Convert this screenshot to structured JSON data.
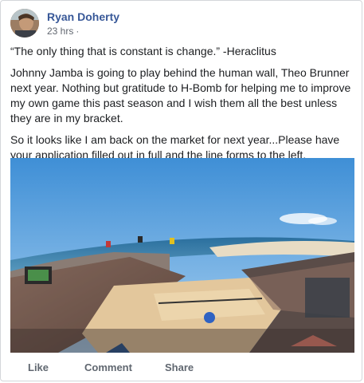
{
  "post": {
    "author": "Ryan Doherty",
    "timestamp": "23 hrs",
    "privacy_separator": "·",
    "paragraphs": [
      "“The only thing that is constant is change.” -Heraclitus",
      "Johnny Jamba is going to play behind the human wall, Theo Brunner next year. Nothing but gratitude to H-Bomb for helping me to improve my own game this past season and I wish them all the best unless they are in my bracket.",
      "So it looks like I am back on the market for next year...Please have your application filled out in full and the line forms to the left."
    ],
    "photo_icon": "beach-volleyball-stadium-photo",
    "avatar_icon": "profile-photo"
  },
  "actions": {
    "like": "Like",
    "comment": "Comment",
    "share": "Share"
  },
  "colors": {
    "author_link": "#385898",
    "meta_text": "#616770",
    "action_text": "#606770"
  }
}
